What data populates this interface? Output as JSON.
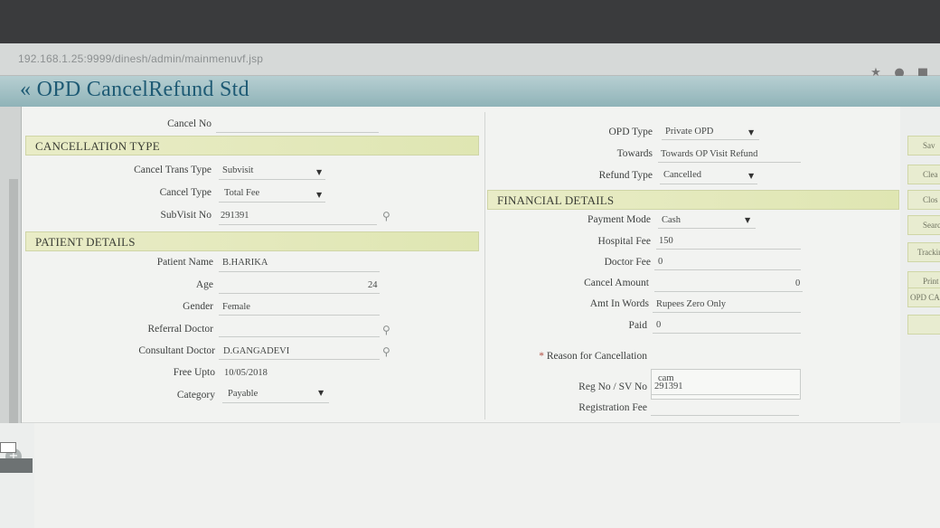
{
  "browser": {
    "url": "192.168.1.25:9999/dinesh/admin/mainmenuvf.jsp"
  },
  "page": {
    "title": "« OPD CancelRefund Std"
  },
  "left": {
    "cancel_no_label": "Cancel No",
    "section_cancellation": "CANCELLATION TYPE",
    "cancel_trans_type_label": "Cancel Trans Type",
    "cancel_trans_type_value": "Subvisit",
    "cancel_type_label": "Cancel Type",
    "cancel_type_value": "Total Fee",
    "subvisit_no_label": "SubVisit No",
    "subvisit_no_value": "291391",
    "section_patient": "PATIENT DETAILS",
    "patient_name_label": "Patient Name",
    "patient_name_value": "B.HARIKA",
    "age_label": "Age",
    "age_value": "24",
    "gender_label": "Gender",
    "gender_value": "Female",
    "referral_doctor_label": "Referral Doctor",
    "consultant_doctor_label": "Consultant Doctor",
    "consultant_doctor_value": "D.GANGADEVI",
    "free_upto_label": "Free Upto",
    "free_upto_value": "10/05/2018",
    "category_label": "Category",
    "category_value": "Payable"
  },
  "right": {
    "opd_type_label": "OPD Type",
    "opd_type_value": "Private OPD",
    "towards_label": "Towards",
    "towards_value": "Towards OP Visit Refund",
    "refund_type_label": "Refund Type",
    "refund_type_value": "Cancelled",
    "section_financial": "FINANCIAL DETAILS",
    "payment_mode_label": "Payment Mode",
    "payment_mode_value": "Cash",
    "hospital_fee_label": "Hospital Fee",
    "hospital_fee_value": "150",
    "doctor_fee_label": "Doctor Fee",
    "doctor_fee_value": "0",
    "cancel_amount_label": "Cancel Amount",
    "cancel_amount_value": "0",
    "amt_in_words_label": "Amt In Words",
    "amt_in_words_value": "Rupees Zero Only",
    "paid_label": "Paid",
    "paid_value": "0",
    "reason_label": "Reason for Cancellation",
    "reason_required_mark": "*",
    "reason_value": "cam",
    "reg_no_label": "Reg No / SV No",
    "reg_no_value": "291391",
    "registration_fee_label": "Registration Fee"
  },
  "side_buttons": [
    "Sav",
    "Clea",
    "Clos",
    "Search",
    "Trackin",
    "Print",
    "OPD CA"
  ],
  "icons": {
    "dropdown": "caret-down-icon",
    "lookup": "magnifier-icon",
    "bookmark": "star-icon"
  }
}
